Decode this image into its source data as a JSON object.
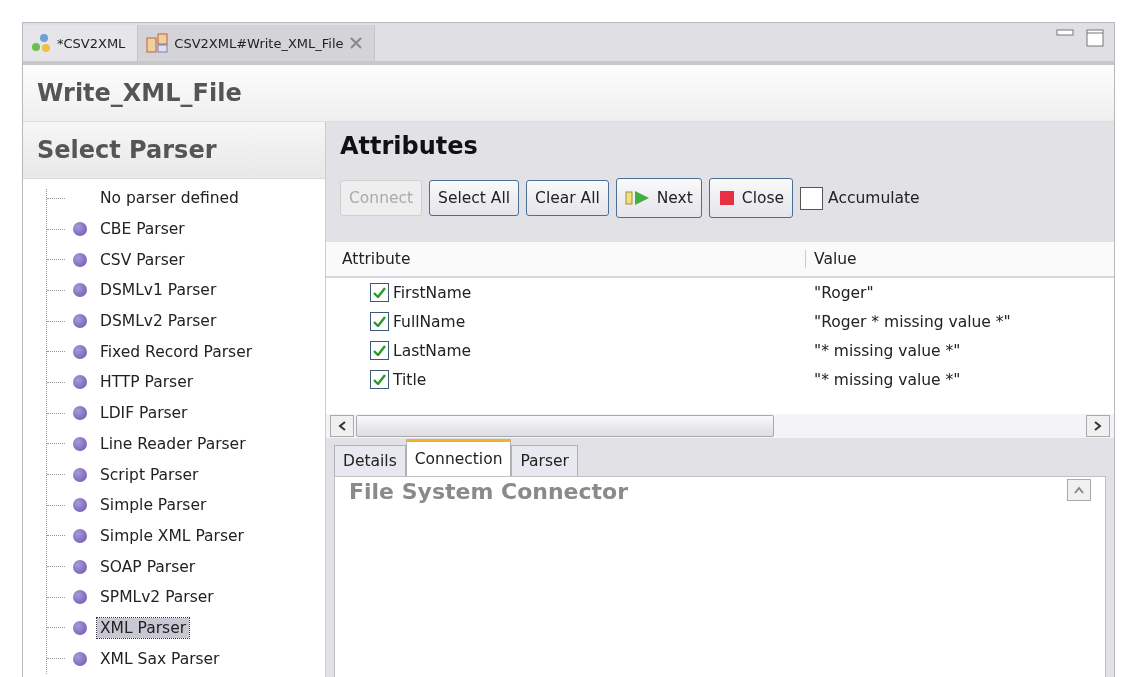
{
  "editor_tabs": [
    {
      "label": "*CSV2XML",
      "kind": "project",
      "selected": false,
      "closable": false
    },
    {
      "label": "CSV2XML#Write_XML_File",
      "kind": "component",
      "selected": true,
      "closable": true
    }
  ],
  "page_title": "Write_XML_File",
  "sidebar": {
    "title": "Select Parser",
    "items": [
      {
        "label": "No parser defined",
        "kind": "empty",
        "selected": false
      },
      {
        "label": "CBE Parser",
        "kind": "parser",
        "selected": false
      },
      {
        "label": "CSV Parser",
        "kind": "parser",
        "selected": false
      },
      {
        "label": "DSMLv1 Parser",
        "kind": "parser",
        "selected": false
      },
      {
        "label": "DSMLv2 Parser",
        "kind": "parser",
        "selected": false
      },
      {
        "label": "Fixed Record Parser",
        "kind": "parser",
        "selected": false
      },
      {
        "label": "HTTP Parser",
        "kind": "parser",
        "selected": false
      },
      {
        "label": "LDIF Parser",
        "kind": "parser",
        "selected": false
      },
      {
        "label": "Line Reader Parser",
        "kind": "parser",
        "selected": false
      },
      {
        "label": "Script Parser",
        "kind": "parser",
        "selected": false
      },
      {
        "label": "Simple Parser",
        "kind": "parser",
        "selected": false
      },
      {
        "label": "Simple XML Parser",
        "kind": "parser",
        "selected": false
      },
      {
        "label": "SOAP Parser",
        "kind": "parser",
        "selected": false
      },
      {
        "label": "SPMLv2 Parser",
        "kind": "parser",
        "selected": false
      },
      {
        "label": "XML Parser",
        "kind": "parser",
        "selected": true
      },
      {
        "label": "XML Sax Parser",
        "kind": "parser",
        "selected": false
      }
    ]
  },
  "attributes": {
    "title": "Attributes",
    "buttons": [
      {
        "label": "Connect",
        "kind": "plain",
        "disabled": true
      },
      {
        "label": "Select All",
        "kind": "plain",
        "disabled": false
      },
      {
        "label": "Clear All",
        "kind": "plain",
        "disabled": false
      },
      {
        "label": "Next",
        "kind": "next",
        "disabled": false
      },
      {
        "label": "Close",
        "kind": "stop",
        "disabled": false
      }
    ],
    "accumulate": {
      "label": "Accumulate",
      "checked": false
    },
    "table": {
      "columns": [
        "Attribute",
        "Value"
      ],
      "rows": [
        {
          "attribute": "FirstName",
          "value": "\"Roger\"",
          "checked": true
        },
        {
          "attribute": "FullName",
          "value": "\"Roger * missing value *\"",
          "checked": true
        },
        {
          "attribute": "LastName",
          "value": "\"* missing value *\"",
          "checked": true
        },
        {
          "attribute": "Title",
          "value": "\"* missing value *\"",
          "checked": true
        }
      ]
    }
  },
  "bottom_tabs": [
    {
      "label": "Details",
      "selected": false
    },
    {
      "label": "Connection",
      "selected": true
    },
    {
      "label": "Parser",
      "selected": false
    }
  ],
  "bottom_panel_title": "File System Connector"
}
